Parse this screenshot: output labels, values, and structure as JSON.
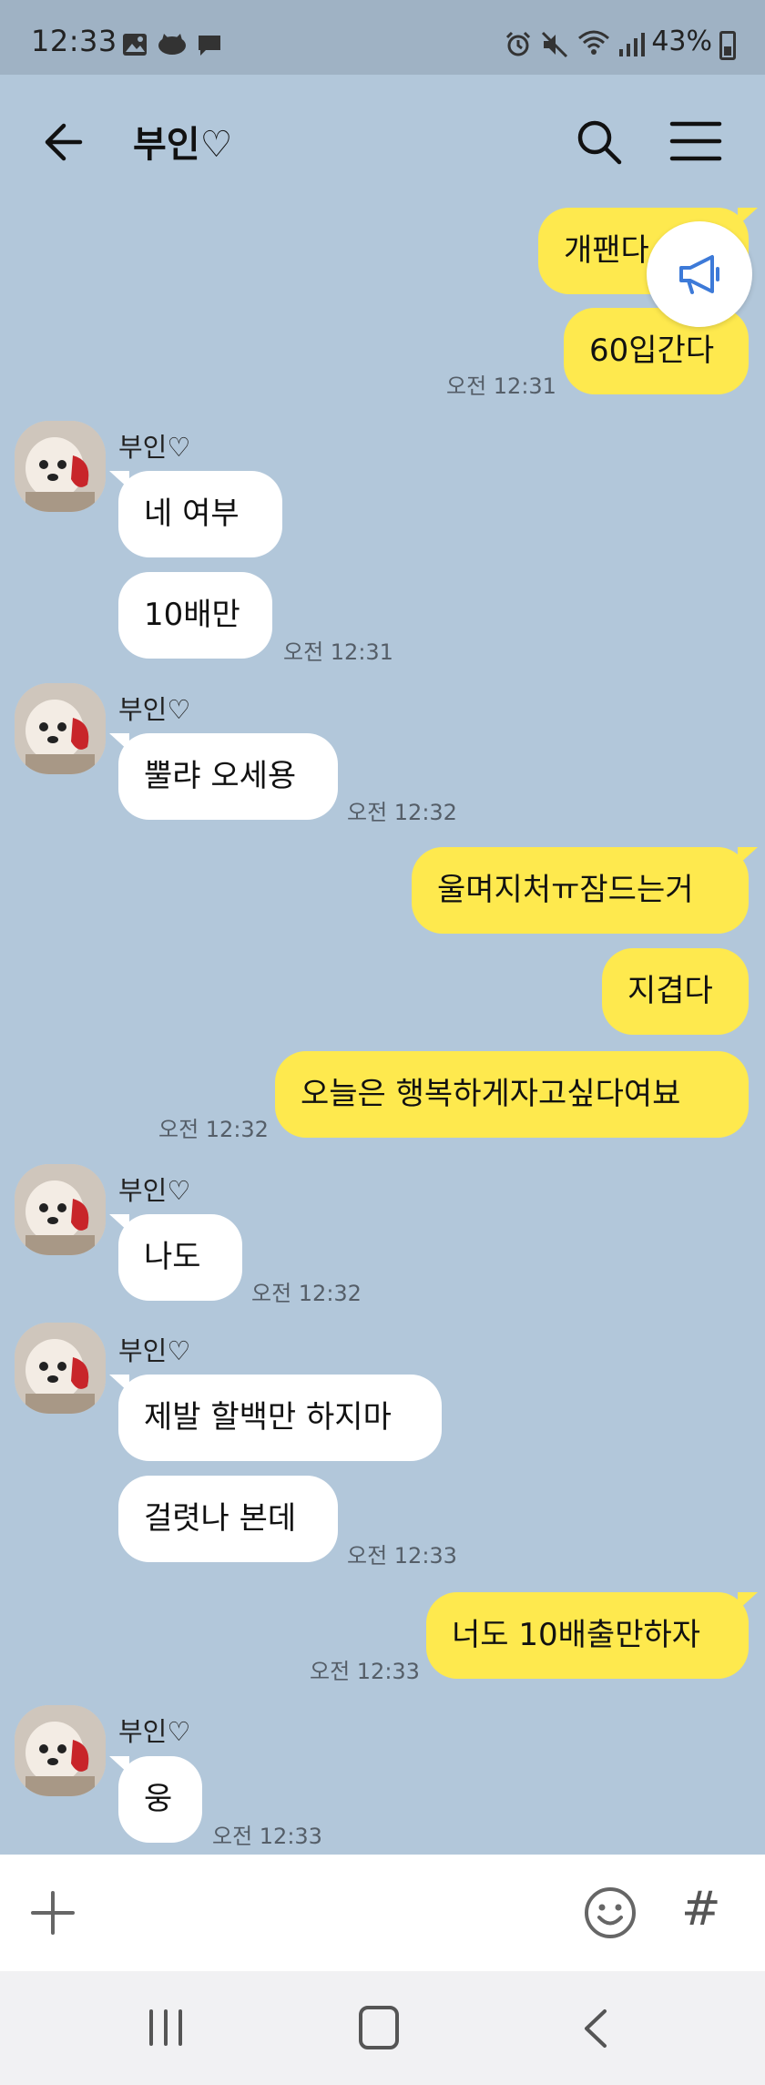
{
  "status_bar": {
    "time": "12:33",
    "battery": "43%",
    "icons": [
      "image-icon",
      "cat-icon",
      "message-icon",
      "alarm-icon",
      "mute-icon",
      "wifi-icon",
      "signal-icon",
      "battery-icon"
    ]
  },
  "header": {
    "title": "부인♡",
    "icons": [
      "back-arrow-icon",
      "search-icon",
      "menu-icon"
    ]
  },
  "notice_fab": {
    "icon": "megaphone-icon"
  },
  "messages": {
    "m1": {
      "text": "개팬다"
    },
    "m2": {
      "text": "60입간다",
      "time": "오전 12:31"
    },
    "g1": {
      "sender": "부인♡"
    },
    "m3": {
      "text": "네 여부"
    },
    "m4": {
      "text": "10배만",
      "time": "오전 12:31"
    },
    "g2": {
      "sender": "부인♡"
    },
    "m5": {
      "text": "뿔랴 오세용",
      "time": "오전 12:32"
    },
    "m6": {
      "text": "울며지처ㅠ잠드는거"
    },
    "m7": {
      "text": "지겹다"
    },
    "m8": {
      "text": "오늘은 행복하게자고싶다여뵤",
      "time": "오전 12:32"
    },
    "g3": {
      "sender": "부인♡"
    },
    "m9": {
      "text": "나도",
      "time": "오전 12:32"
    },
    "g4": {
      "sender": "부인♡"
    },
    "m10": {
      "text": "제발 할백만 하지마"
    },
    "m11": {
      "text": "걸렷나 본데",
      "time": "오전 12:33"
    },
    "m12": {
      "text": "너도 10배출만하자",
      "time": "오전 12:33"
    },
    "g5": {
      "sender": "부인♡"
    },
    "m13": {
      "text": "웅",
      "time": "오전 12:33"
    }
  },
  "input_bar": {
    "icons": [
      "plus-icon",
      "emoji-icon",
      "hash-icon"
    ],
    "hash_glyph": "#"
  },
  "nav_bar": {
    "icons": [
      "recent-apps-icon",
      "home-icon",
      "nav-back-icon"
    ]
  },
  "colors": {
    "chat_bg": "#b2c7da",
    "my_bubble": "#fee94e",
    "other_bubble": "#ffffff",
    "status_bar": "#9fb2c4"
  }
}
